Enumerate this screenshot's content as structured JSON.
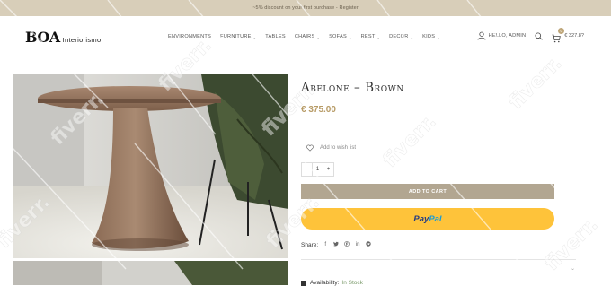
{
  "announcement": "~5% discount on your first purchase - Register",
  "brand": {
    "mark": "BOA",
    "name": "Interiorismo"
  },
  "nav": [
    {
      "label": "ENVIRONMENTS",
      "has_dropdown": false
    },
    {
      "label": "FURNITURE",
      "has_dropdown": true
    },
    {
      "label": "TABLES",
      "has_dropdown": false
    },
    {
      "label": "CHAIRS",
      "has_dropdown": true
    },
    {
      "label": "SOFAS",
      "has_dropdown": true
    },
    {
      "label": "REST",
      "has_dropdown": true
    },
    {
      "label": "DECOR",
      "has_dropdown": true
    },
    {
      "label": "KIDS",
      "has_dropdown": true
    }
  ],
  "header": {
    "user_label": "HELLO, ADMIN",
    "cart_count": "0",
    "cart_total": "€ 327.8?"
  },
  "product": {
    "title": "Abelone – Brown",
    "price": "€ 375.00",
    "wishlist_label": "Add to wish list",
    "quantity": "1",
    "add_to_cart_label": "ADD TO CART",
    "paypal_label": "PayPal",
    "share_label": "Share:",
    "share_icons": [
      "facebook-icon",
      "twitter-icon",
      "pinterest-icon",
      "linkedin-icon",
      "telegram-icon"
    ],
    "availability_label": "Availability:",
    "availability_value": "In Stock"
  },
  "watermark": "fiverr.",
  "colors": {
    "accent": "#b79b66",
    "topbar": "#d8ceb9",
    "add_to_cart": "#b2a691",
    "paypal": "#fec33a"
  }
}
